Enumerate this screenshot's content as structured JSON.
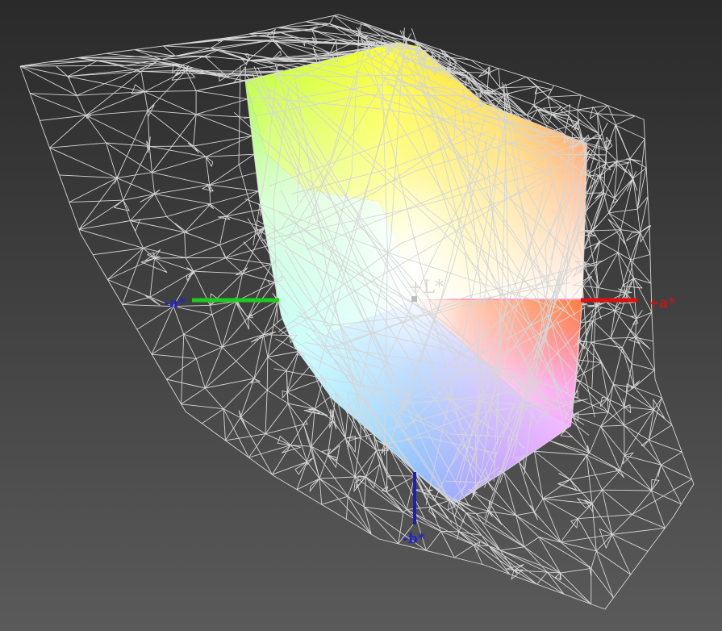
{
  "axes": {
    "lstar": {
      "label": "+L*",
      "color": "#d8d8d8"
    },
    "minus_a": {
      "label": "-a*",
      "color": "#1ecb1e",
      "label_color": "#2222cc"
    },
    "plus_a": {
      "label": "+a*",
      "color": "#dd1111",
      "label_color": "#cc1111"
    },
    "minus_b": {
      "label": "-b*",
      "color": "#1a1ad8",
      "label_color": "#2222cc"
    }
  },
  "colors": {
    "wireframe": "#d6d6d6",
    "background_top": "#2a2a2a",
    "background_bottom": "#5a5a5a"
  }
}
